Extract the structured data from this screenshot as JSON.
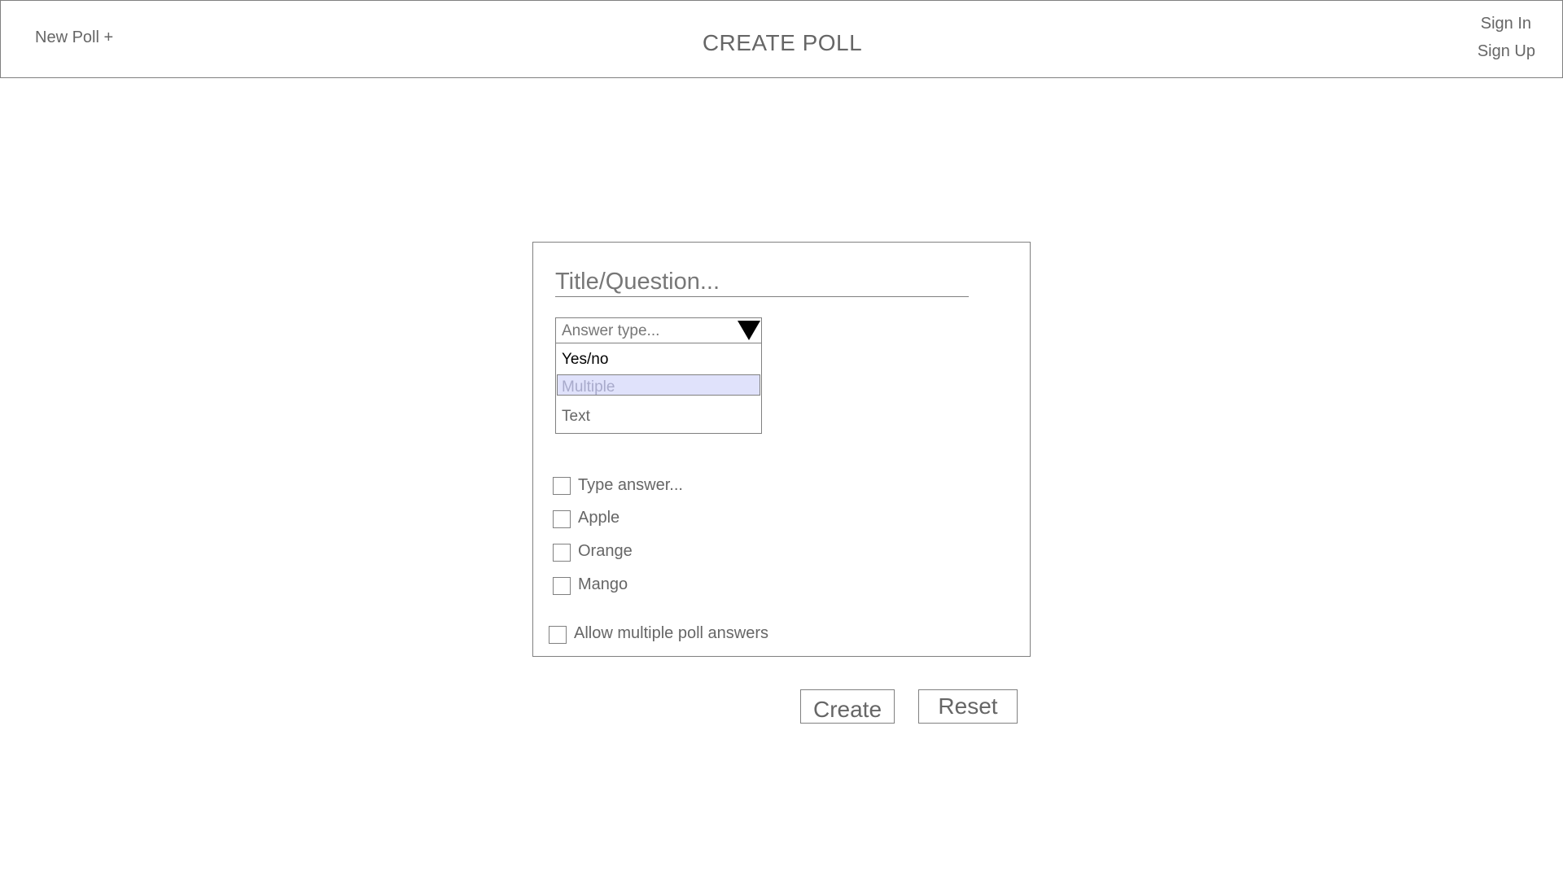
{
  "header": {
    "new_poll_label": "New Poll +",
    "title": "CREATE POLL",
    "sign_in_label": "Sign In",
    "sign_up_label": "Sign Up"
  },
  "form": {
    "title_placeholder": "Title/Question...",
    "title_value": "",
    "answer_type": {
      "placeholder": "Answer type...",
      "options": [
        "Yes/no",
        "Multiple",
        "Text"
      ],
      "highlighted_option": "Multiple"
    },
    "new_answer_placeholder": "Type answer...",
    "answers": [
      {
        "label": "Apple",
        "checked": false
      },
      {
        "label": "Orange",
        "checked": false
      },
      {
        "label": "Mango",
        "checked": false
      }
    ],
    "allow_multiple_label": "Allow multiple poll answers",
    "allow_multiple_checked": false
  },
  "actions": {
    "create_label": "Create",
    "reset_label": "Reset"
  },
  "colors": {
    "border": "#808080",
    "text": "#666666",
    "highlight_bg": "#e0e2fb",
    "highlight_text": "#a8aacb"
  },
  "icons": {
    "dropdown": "triangle-down-icon"
  }
}
